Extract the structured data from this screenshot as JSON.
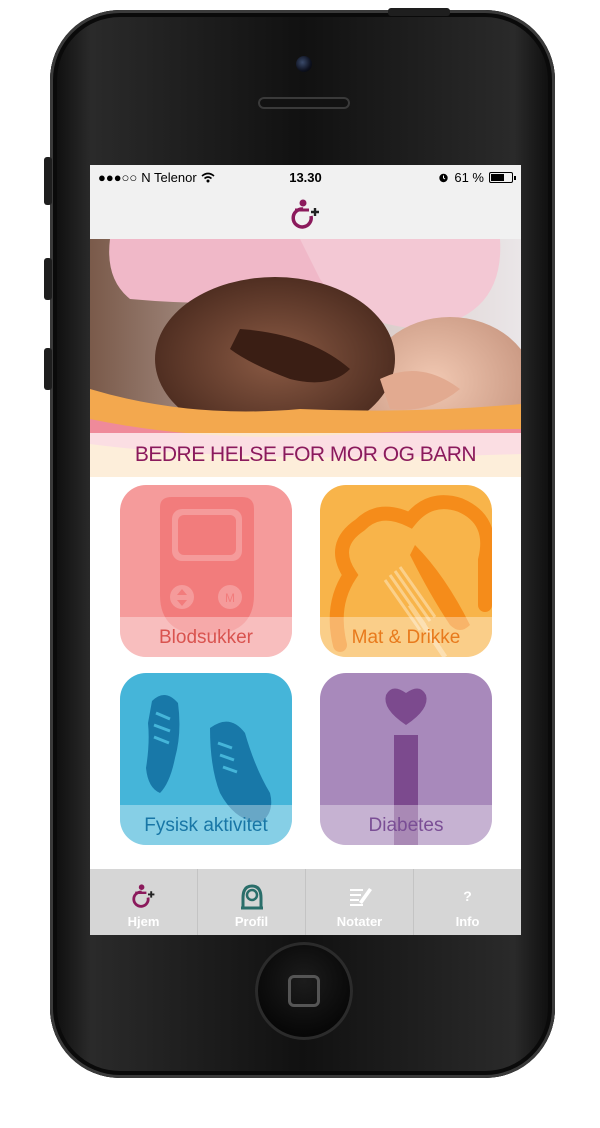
{
  "status_bar": {
    "signal": "●●●○○",
    "carrier": "N Telenor",
    "time": "13.30",
    "battery_text": "61 %",
    "battery_level": 0.61
  },
  "hero": {
    "title": "BEDRE HELSE FOR MOR OG BARN"
  },
  "tiles": [
    {
      "label": "Blodsukker",
      "color": "#f59b9b",
      "icon": "glucose-meter-icon"
    },
    {
      "label": "Mat & Drikke",
      "color": "#f8b44a",
      "icon": "food-heart-icon"
    },
    {
      "label": "Fysisk aktivitet",
      "color": "#45b5d9",
      "icon": "shoes-icon"
    },
    {
      "label": "Diabetes",
      "color": "#a889bb",
      "icon": "info-heart-icon"
    }
  ],
  "tabs": [
    {
      "label": "Hjem",
      "icon": "home-logo-icon"
    },
    {
      "label": "Profil",
      "icon": "profile-icon"
    },
    {
      "label": "Notater",
      "icon": "notes-icon"
    },
    {
      "label": "Info",
      "icon": "info-icon"
    }
  ],
  "colors": {
    "brand": "#8b1a5c",
    "tab_bar": "#d6d6d6"
  }
}
